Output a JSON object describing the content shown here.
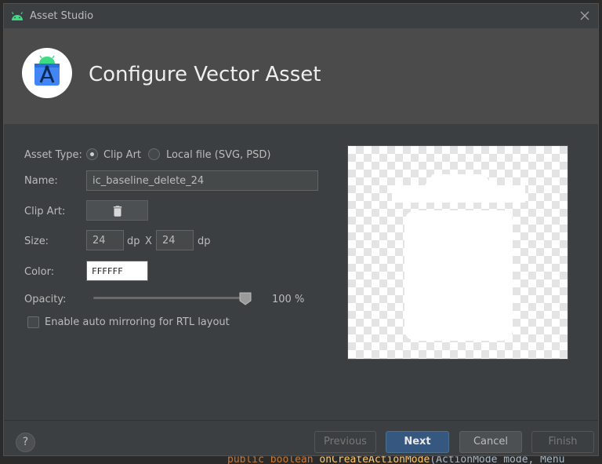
{
  "window": {
    "title": "Asset Studio"
  },
  "header": {
    "title": "Configure Vector Asset"
  },
  "form": {
    "asset_type_label": "Asset Type:",
    "asset_type_options": [
      "Clip Art",
      "Local file (SVG, PSD)"
    ],
    "asset_type_selected": "Clip Art",
    "name_label": "Name:",
    "name_value": "ic_baseline_delete_24",
    "clip_art_label": "Clip Art:",
    "clip_art_icon": "delete-icon",
    "size_label": "Size:",
    "width_value": "24",
    "width_unit": "dp",
    "size_separator": "X",
    "height_value": "24",
    "height_unit": "dp",
    "color_label": "Color:",
    "color_value": "FFFFFF",
    "opacity_label": "Opacity:",
    "opacity_value": 100,
    "opacity_text": "100 %",
    "mirroring_label": "Enable auto mirroring for RTL layout",
    "mirroring_checked": false
  },
  "preview": {
    "icon": "delete-icon",
    "icon_color": "#FFFFFF"
  },
  "footer": {
    "help_label": "?",
    "previous_label": "Previous",
    "next_label": "Next",
    "cancel_label": "Cancel",
    "finish_label": "Finish"
  },
  "background_code": {
    "keyword": "public boolean ",
    "method": "onCreateActionMode",
    "rest": "(ActionMode mode, Menu"
  },
  "colors": {
    "accent": "#365880",
    "header_bg": "#4b4b4b",
    "dialog_bg": "#3c3f41"
  }
}
